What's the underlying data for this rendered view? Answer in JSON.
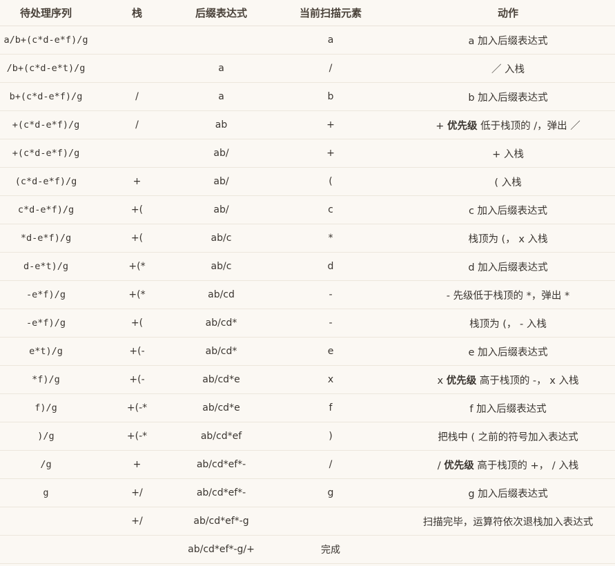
{
  "headers": {
    "queue": "待处理序列",
    "stack": "栈",
    "postfix": "后缀表达式",
    "current": "当前扫描元素",
    "action": "动作"
  },
  "rows": [
    {
      "queue": "a/b+(c*d-e*f)/g",
      "stack": "",
      "postfix": "",
      "current": "a",
      "action": [
        {
          "t": "a 加入后缀表达式"
        }
      ]
    },
    {
      "queue": "/b+(c*d-e*t)/g",
      "stack": "",
      "postfix": "a",
      "current": "/",
      "action": [
        {
          "t": "／ 入栈"
        }
      ]
    },
    {
      "queue": "b+(c*d-e*f)/g",
      "stack": "/",
      "postfix": "a",
      "current": "b",
      "action": [
        {
          "t": "b 加入后缀表达式"
        }
      ]
    },
    {
      "queue": "+(c*d-e*f)/g",
      "stack": "/",
      "postfix": "ab",
      "current": "+",
      "action": [
        {
          "t": "+ "
        },
        {
          "t": "优先级",
          "b": true
        },
        {
          "t": " 低于栈顶的 /，弹出 ／"
        }
      ]
    },
    {
      "queue": "+(c*d-e*f)/g",
      "stack": "",
      "postfix": "ab/",
      "current": "+",
      "action": [
        {
          "t": "+ 入栈"
        }
      ]
    },
    {
      "queue": "(c*d-e*f)/g",
      "stack": "+",
      "postfix": "ab/",
      "current": "(",
      "action": [
        {
          "t": "( 入栈"
        }
      ]
    },
    {
      "queue": "c*d-e*f)/g",
      "stack": "+(",
      "postfix": "ab/",
      "current": "c",
      "action": [
        {
          "t": "c 加入后缀表达式"
        }
      ]
    },
    {
      "queue": "*d-e*f)/g",
      "stack": "+(",
      "postfix": "ab/c",
      "current": "*",
      "action": [
        {
          "t": "栈顶为 (， ⅹ 入栈"
        }
      ]
    },
    {
      "queue": "d-e*t)/g",
      "stack": "+(*",
      "postfix": "ab/c",
      "current": "d",
      "action": [
        {
          "t": "d 加入后缀表达式"
        }
      ]
    },
    {
      "queue": "-e*f)/g",
      "stack": "+(*",
      "postfix": "ab/cd",
      "current": "-",
      "action": [
        {
          "t": "- 先级低于栈顶的 *，弹出 *"
        }
      ]
    },
    {
      "queue": "-e*f)/g",
      "stack": "+(",
      "postfix": "ab/cd*",
      "current": "-",
      "action": [
        {
          "t": "栈顶为 (， - 入栈"
        }
      ]
    },
    {
      "queue": "e*t)/g",
      "stack": "+(-",
      "postfix": "ab/cd*",
      "current": "e",
      "action": [
        {
          "t": "e 加入后缀表达式"
        }
      ]
    },
    {
      "queue": "*f)/g",
      "stack": "+(-",
      "postfix": "ab/cd*e",
      "current": "ⅹ",
      "action": [
        {
          "t": "ⅹ "
        },
        {
          "t": "优先级",
          "b": true
        },
        {
          "t": " 高于栈顶的 -， ⅹ 入栈"
        }
      ]
    },
    {
      "queue": "f)/g",
      "stack": "+(-*",
      "postfix": "ab/cd*e",
      "current": "f",
      "action": [
        {
          "t": "f 加入后缀表达式"
        }
      ]
    },
    {
      "queue": ")/g",
      "stack": "+(-*",
      "postfix": "ab/cd*ef",
      "current": ")",
      "action": [
        {
          "t": "把栈中 ( 之前的符号加入表达式"
        }
      ]
    },
    {
      "queue": "/g",
      "stack": "+",
      "postfix": "ab/cd*ef*-",
      "current": "/",
      "action": [
        {
          "t": "/ "
        },
        {
          "t": "优先级",
          "b": true
        },
        {
          "t": " 高于栈顶的 +， / 入栈"
        }
      ]
    },
    {
      "queue": "g",
      "stack": "+/",
      "postfix": "ab/cd*ef*-",
      "current": "g",
      "action": [
        {
          "t": "g 加入后缀表达式"
        }
      ]
    },
    {
      "queue": "",
      "stack": "+/",
      "postfix": "ab/cd*ef*-g",
      "current": "",
      "action": [
        {
          "t": "扫描完毕，运算符依次退栈加入表达式"
        }
      ]
    },
    {
      "queue": "",
      "stack": "",
      "postfix": "ab/cd*ef*-g/+",
      "current": "完成",
      "action": []
    }
  ]
}
